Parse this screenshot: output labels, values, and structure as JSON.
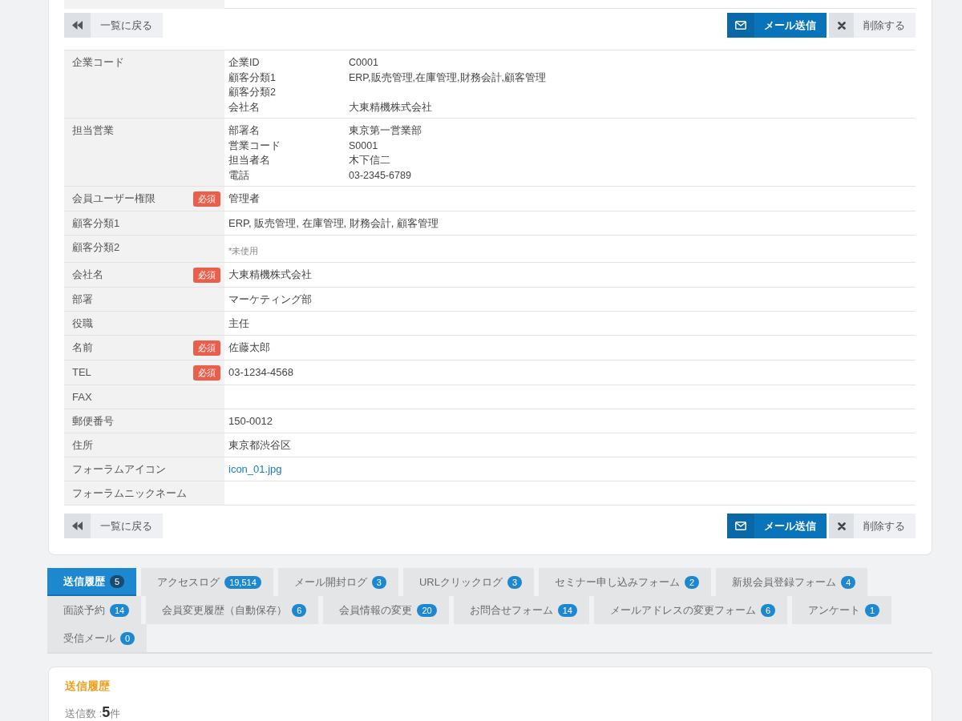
{
  "actions_top": [
    {
      "kind": "back",
      "label": "一覧に戻る"
    },
    {
      "kind": "send_mail",
      "label": "メール送信"
    },
    {
      "kind": "delete",
      "label": "削除する"
    }
  ],
  "detail_rows": [
    {
      "kind": "group",
      "label": "企業コード",
      "items": [
        {
          "key": "企業ID",
          "value": "C0001"
        },
        {
          "key": "顧客分類1",
          "value": "ERP,販売管理,在庫管理,財務会計,顧客管理"
        },
        {
          "key": "顧客分類2"
        },
        {
          "key": "会社名",
          "value": "大東精機株式会社"
        }
      ]
    },
    {
      "kind": "group",
      "label": "担当営業",
      "items": [
        {
          "key": "部署名",
          "value": "東京第一営業部"
        },
        {
          "key": "営業コード",
          "value": "S0001"
        },
        {
          "key": "担当者名",
          "value": "木下信二"
        },
        {
          "key": "電話",
          "value": "03-2345-6789"
        }
      ]
    },
    {
      "kind": "field",
      "label": "会員ユーザー権限",
      "badge": "必須",
      "value": "管理者"
    },
    {
      "kind": "field",
      "label": "顧客分類1",
      "value": "ERP, 販売管理, 在庫管理, 財務会計, 顧客管理"
    },
    {
      "kind": "note",
      "label": "顧客分類2",
      "value": "*未使用"
    },
    {
      "kind": "field",
      "label": "会社名",
      "badge": "必須",
      "value": "大東精機株式会社"
    },
    {
      "kind": "field",
      "label": "部署",
      "value": "マーケティング部"
    },
    {
      "kind": "field",
      "label": "役職",
      "value": "主任"
    },
    {
      "kind": "field",
      "label": "名前",
      "badge": "必須",
      "value": "佐藤太郎"
    },
    {
      "kind": "field",
      "label": "TEL",
      "badge": "必須",
      "value": "03-1234-4568"
    },
    {
      "kind": "field",
      "label": "FAX"
    },
    {
      "kind": "field",
      "label": "郵便番号",
      "value": "150-0012"
    },
    {
      "kind": "field",
      "label": "住所",
      "value": "東京都渋谷区"
    },
    {
      "kind": "link",
      "label": "フォーラムアイコン",
      "value": "icon_01.jpg"
    },
    {
      "kind": "field",
      "label": "フォーラムニックネーム"
    }
  ],
  "actions_bottom": [
    {
      "kind": "back",
      "label": "一覧に戻る"
    },
    {
      "kind": "send_mail",
      "label": "メール送信"
    },
    {
      "kind": "delete",
      "label": "削除する"
    }
  ],
  "tabs": [
    {
      "label": "送信履歴",
      "count": "5",
      "selected": true
    },
    {
      "label": "アクセスログ",
      "count": "19,514",
      "selected": false
    },
    {
      "label": "メール開封ログ",
      "count": "3",
      "selected": false
    },
    {
      "label": "URLクリックログ",
      "count": "3",
      "selected": false
    },
    {
      "label": "セミナー申し込みフォーム",
      "count": "2",
      "selected": false
    },
    {
      "label": "新規会員登録フォーム",
      "count": "4",
      "selected": false
    },
    {
      "label": "面談予約",
      "count": "14",
      "selected": false
    },
    {
      "label": "会員変更履歴（自動保存）",
      "count": "6",
      "selected": false
    },
    {
      "label": "会員情報の変更",
      "count": "20",
      "selected": false
    },
    {
      "label": "お問合せフォーム",
      "count": "14",
      "selected": false
    },
    {
      "label": "メールアドレスの変更フォーム",
      "count": "6",
      "selected": false
    },
    {
      "label": "アンケート",
      "count": "1",
      "selected": false
    },
    {
      "label": "受信メール",
      "count": "0",
      "selected": false
    }
  ],
  "send_history": {
    "title": "送信履歴",
    "count_text": "送信数 :**5**件"
  }
}
